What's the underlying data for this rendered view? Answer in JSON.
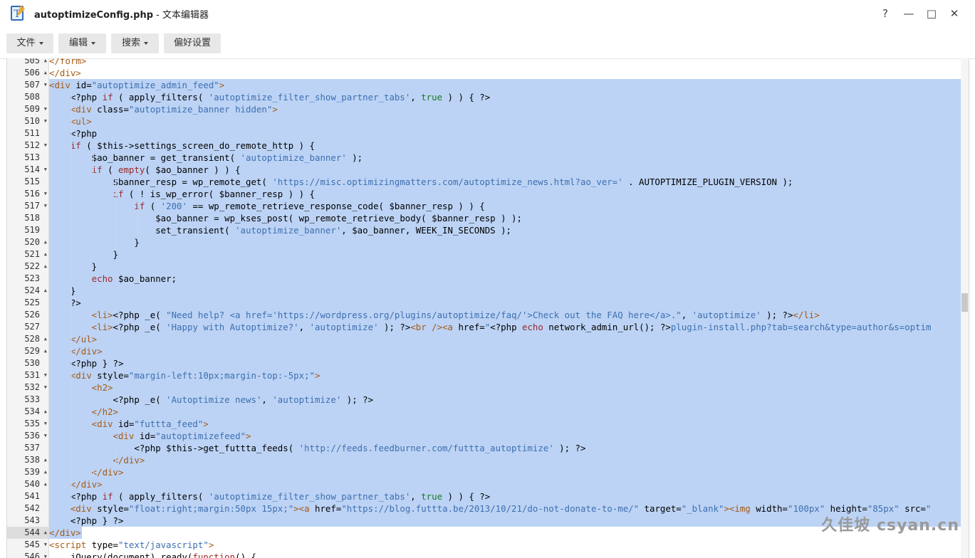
{
  "window": {
    "filename": "autoptimizeConfig.php",
    "app_suffix": " - 文本编辑器",
    "help_glyph": "?",
    "minimize_glyph": "—",
    "maximize_glyph": "□",
    "close_glyph": "✕"
  },
  "menu": [
    {
      "label": "文件",
      "dropdown": true
    },
    {
      "label": "编辑",
      "dropdown": true
    },
    {
      "label": "搜索",
      "dropdown": true
    },
    {
      "label": "偏好设置",
      "dropdown": false
    }
  ],
  "watermark": "久佳坡 csyan.cn",
  "editor": {
    "current_line": 544,
    "lines": [
      {
        "n": 505,
        "fold": "up",
        "sel": false,
        "segs": [
          [
            "t",
            "</form>"
          ]
        ]
      },
      {
        "n": 506,
        "fold": "up",
        "sel": false,
        "segs": [
          [
            "t",
            "</div>"
          ]
        ]
      },
      {
        "n": 507,
        "fold": "down",
        "sel": true,
        "segs": [
          [
            "t",
            "<div "
          ],
          [
            "c",
            "id="
          ],
          [
            "s",
            "\"autoptimize_admin_feed\""
          ],
          [
            "t",
            ">"
          ]
        ]
      },
      {
        "n": 508,
        "fold": "",
        "sel": true,
        "segs": [
          [
            "c",
            "    <?php "
          ],
          [
            "k",
            "if"
          ],
          [
            "c",
            " ( apply_filters( "
          ],
          [
            "s",
            "'autoptimize_filter_show_partner_tabs'"
          ],
          [
            "c",
            ", "
          ],
          [
            "g",
            "true"
          ],
          [
            "c",
            " ) ) { ?>"
          ]
        ]
      },
      {
        "n": 509,
        "fold": "down",
        "sel": true,
        "segs": [
          [
            "t",
            "    <div "
          ],
          [
            "c",
            "class="
          ],
          [
            "s",
            "\"autoptimize_banner hidden\""
          ],
          [
            "t",
            ">"
          ]
        ]
      },
      {
        "n": 510,
        "fold": "down",
        "sel": true,
        "segs": [
          [
            "t",
            "    <ul>"
          ]
        ]
      },
      {
        "n": 511,
        "fold": "",
        "sel": true,
        "segs": [
          [
            "c",
            "    <?php"
          ]
        ]
      },
      {
        "n": 512,
        "fold": "down",
        "sel": true,
        "segs": [
          [
            "k",
            "    if"
          ],
          [
            "c",
            " ( $this->settings_screen_do_remote_http ) {"
          ]
        ]
      },
      {
        "n": 513,
        "fold": "",
        "sel": true,
        "segs": [
          [
            "c",
            "        $ao_banner = get_transient( "
          ],
          [
            "s",
            "'autoptimize_banner'"
          ],
          [
            "c",
            " );"
          ]
        ]
      },
      {
        "n": 514,
        "fold": "down",
        "sel": true,
        "segs": [
          [
            "k",
            "        if"
          ],
          [
            "c",
            " ( "
          ],
          [
            "k",
            "empty"
          ],
          [
            "c",
            "( $ao_banner ) ) {"
          ]
        ]
      },
      {
        "n": 515,
        "fold": "",
        "sel": true,
        "segs": [
          [
            "c",
            "            $banner_resp = wp_remote_get( "
          ],
          [
            "s",
            "'https://misc.optimizingmatters.com/autoptimize_news.html?ao_ver='"
          ],
          [
            "c",
            " . AUTOPTIMIZE_PLUGIN_VERSION );"
          ]
        ]
      },
      {
        "n": 516,
        "fold": "down",
        "sel": true,
        "segs": [
          [
            "k",
            "            if"
          ],
          [
            "c",
            " ( ! is_wp_error( $banner_resp ) ) {"
          ]
        ]
      },
      {
        "n": 517,
        "fold": "down",
        "sel": true,
        "segs": [
          [
            "k",
            "                if"
          ],
          [
            "c",
            " ( "
          ],
          [
            "s",
            "'200'"
          ],
          [
            "c",
            " == wp_remote_retrieve_response_code( $banner_resp ) ) {"
          ]
        ]
      },
      {
        "n": 518,
        "fold": "",
        "sel": true,
        "segs": [
          [
            "c",
            "                    $ao_banner = wp_kses_post( wp_remote_retrieve_body( $banner_resp ) );"
          ]
        ]
      },
      {
        "n": 519,
        "fold": "",
        "sel": true,
        "segs": [
          [
            "c",
            "                    set_transient( "
          ],
          [
            "s",
            "'autoptimize_banner'"
          ],
          [
            "c",
            ", $ao_banner, WEEK_IN_SECONDS );"
          ]
        ]
      },
      {
        "n": 520,
        "fold": "up",
        "sel": true,
        "segs": [
          [
            "c",
            "                }"
          ]
        ]
      },
      {
        "n": 521,
        "fold": "up",
        "sel": true,
        "segs": [
          [
            "c",
            "            }"
          ]
        ]
      },
      {
        "n": 522,
        "fold": "up",
        "sel": true,
        "segs": [
          [
            "c",
            "        }"
          ]
        ]
      },
      {
        "n": 523,
        "fold": "",
        "sel": true,
        "segs": [
          [
            "k",
            "        echo"
          ],
          [
            "c",
            " $ao_banner;"
          ]
        ]
      },
      {
        "n": 524,
        "fold": "up",
        "sel": true,
        "segs": [
          [
            "c",
            "    }"
          ]
        ]
      },
      {
        "n": 525,
        "fold": "",
        "sel": true,
        "segs": [
          [
            "c",
            "    ?>"
          ]
        ]
      },
      {
        "n": 526,
        "fold": "",
        "sel": true,
        "segs": [
          [
            "t",
            "        <li>"
          ],
          [
            "c",
            "<?php _e( "
          ],
          [
            "s",
            "\"Need help? <a href='https://wordpress.org/plugins/autoptimize/faq/'>Check out the FAQ here</a>.\""
          ],
          [
            "c",
            ", "
          ],
          [
            "s",
            "'autoptimize'"
          ],
          [
            "c",
            " ); ?>"
          ],
          [
            "t",
            "</li>"
          ]
        ]
      },
      {
        "n": 527,
        "fold": "",
        "sel": true,
        "segs": [
          [
            "t",
            "        <li>"
          ],
          [
            "c",
            "<?php _e( "
          ],
          [
            "s",
            "'Happy with Autoptimize?'"
          ],
          [
            "c",
            ", "
          ],
          [
            "s",
            "'autoptimize'"
          ],
          [
            "c",
            " ); ?>"
          ],
          [
            "t",
            "<br /><a "
          ],
          [
            "c",
            "href="
          ],
          [
            "s",
            "\""
          ],
          [
            "c",
            "<?php "
          ],
          [
            "k",
            "echo"
          ],
          [
            "c",
            " network_admin_url(); ?>"
          ],
          [
            "s",
            "plugin-install.php?tab=search&type=author&s=optim"
          ]
        ]
      },
      {
        "n": 528,
        "fold": "up",
        "sel": true,
        "segs": [
          [
            "t",
            "    </ul>"
          ]
        ]
      },
      {
        "n": 529,
        "fold": "up",
        "sel": true,
        "segs": [
          [
            "t",
            "    </div>"
          ]
        ]
      },
      {
        "n": 530,
        "fold": "",
        "sel": true,
        "segs": [
          [
            "c",
            "    <?php } ?>"
          ]
        ]
      },
      {
        "n": 531,
        "fold": "down",
        "sel": true,
        "segs": [
          [
            "t",
            "    <div "
          ],
          [
            "c",
            "style="
          ],
          [
            "s",
            "\"margin-left:10px;margin-top:-5px;\""
          ],
          [
            "t",
            ">"
          ]
        ]
      },
      {
        "n": 532,
        "fold": "down",
        "sel": true,
        "segs": [
          [
            "t",
            "        <h2>"
          ]
        ]
      },
      {
        "n": 533,
        "fold": "",
        "sel": true,
        "segs": [
          [
            "c",
            "            <?php _e( "
          ],
          [
            "s",
            "'Autoptimize news'"
          ],
          [
            "c",
            ", "
          ],
          [
            "s",
            "'autoptimize'"
          ],
          [
            "c",
            " ); ?>"
          ]
        ]
      },
      {
        "n": 534,
        "fold": "up",
        "sel": true,
        "segs": [
          [
            "t",
            "        </h2>"
          ]
        ]
      },
      {
        "n": 535,
        "fold": "down",
        "sel": true,
        "segs": [
          [
            "t",
            "        <div "
          ],
          [
            "c",
            "id="
          ],
          [
            "s",
            "\"futtta_feed\""
          ],
          [
            "t",
            ">"
          ]
        ]
      },
      {
        "n": 536,
        "fold": "down",
        "sel": true,
        "segs": [
          [
            "t",
            "            <div "
          ],
          [
            "c",
            "id="
          ],
          [
            "s",
            "\"autoptimizefeed\""
          ],
          [
            "t",
            ">"
          ]
        ]
      },
      {
        "n": 537,
        "fold": "",
        "sel": true,
        "segs": [
          [
            "c",
            "                <?php $this->get_futtta_feeds( "
          ],
          [
            "s",
            "'http://feeds.feedburner.com/futtta_autoptimize'"
          ],
          [
            "c",
            " ); ?>"
          ]
        ]
      },
      {
        "n": 538,
        "fold": "up",
        "sel": true,
        "segs": [
          [
            "t",
            "            </div>"
          ]
        ]
      },
      {
        "n": 539,
        "fold": "up",
        "sel": true,
        "segs": [
          [
            "t",
            "        </div>"
          ]
        ]
      },
      {
        "n": 540,
        "fold": "up",
        "sel": true,
        "segs": [
          [
            "t",
            "    </div>"
          ]
        ]
      },
      {
        "n": 541,
        "fold": "",
        "sel": true,
        "segs": [
          [
            "c",
            "    <?php "
          ],
          [
            "k",
            "if"
          ],
          [
            "c",
            " ( apply_filters( "
          ],
          [
            "s",
            "'autoptimize_filter_show_partner_tabs'"
          ],
          [
            "c",
            ", "
          ],
          [
            "g",
            "true"
          ],
          [
            "c",
            " ) ) { ?>"
          ]
        ]
      },
      {
        "n": 542,
        "fold": "",
        "sel": true,
        "segs": [
          [
            "t",
            "    <div "
          ],
          [
            "c",
            "style="
          ],
          [
            "s",
            "\"float:right;margin:50px 15px;\""
          ],
          [
            "t",
            "><a "
          ],
          [
            "c",
            "href="
          ],
          [
            "s",
            "\"https://blog.futtta.be/2013/10/21/do-not-donate-to-me/\""
          ],
          [
            "c",
            " target="
          ],
          [
            "s",
            "\"_blank\""
          ],
          [
            "t",
            "><img "
          ],
          [
            "c",
            "width="
          ],
          [
            "s",
            "\"100px\""
          ],
          [
            "c",
            " height="
          ],
          [
            "s",
            "\"85px\""
          ],
          [
            "c",
            " src="
          ],
          [
            "s",
            "\""
          ]
        ]
      },
      {
        "n": 543,
        "fold": "",
        "sel": true,
        "segs": [
          [
            "c",
            "    <?php } ?>"
          ]
        ]
      },
      {
        "n": 544,
        "fold": "up",
        "sel": "partial",
        "segs": [
          [
            "t",
            "</div>"
          ]
        ]
      },
      {
        "n": 545,
        "fold": "down",
        "sel": false,
        "segs": [
          [
            "t",
            "<script "
          ],
          [
            "c",
            "type="
          ],
          [
            "s",
            "\"text/javascript\""
          ],
          [
            "t",
            ">"
          ]
        ]
      },
      {
        "n": 546,
        "fold": "down",
        "sel": false,
        "segs": [
          [
            "c",
            "    jQuery(document).ready("
          ],
          [
            "k",
            "function"
          ],
          [
            "c",
            "() {"
          ]
        ]
      }
    ]
  }
}
